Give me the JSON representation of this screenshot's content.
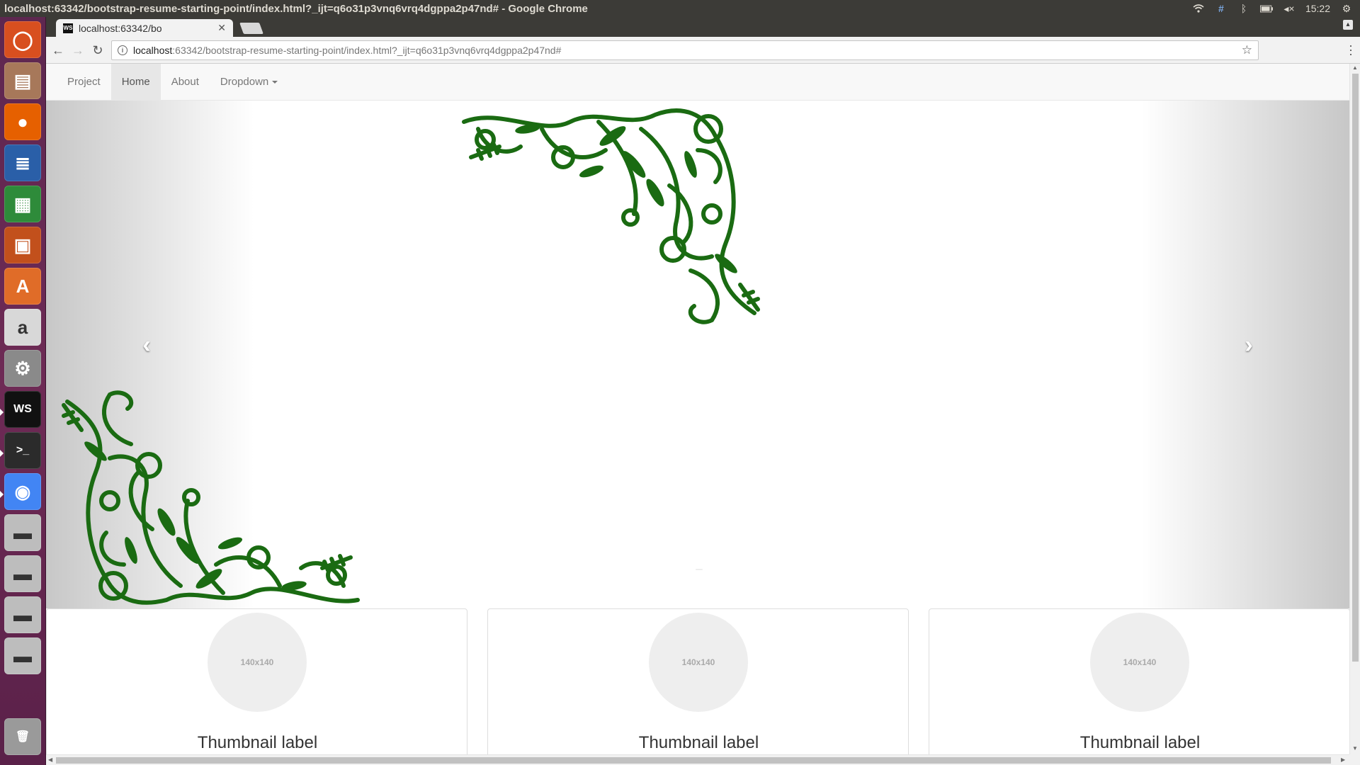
{
  "window": {
    "title": "localhost:63342/bootstrap-resume-starting-point/index.html?_ijt=q6o31p3vnq6vrq4dgppa2p47nd# - Google Chrome",
    "clock": "15:22"
  },
  "tray_icons": [
    "wifi-icon",
    "keyboard-icon",
    "bluetooth-icon",
    "battery-icon",
    "volume-icon",
    "settings-gear-icon"
  ],
  "launcher": {
    "items": [
      {
        "name": "ubuntu-dash-icon",
        "color": "#d84f1f",
        "glyph": "◯"
      },
      {
        "name": "files-icon",
        "color": "#a7785a",
        "glyph": "▤"
      },
      {
        "name": "firefox-icon",
        "color": "#e66000",
        "glyph": "●"
      },
      {
        "name": "writer-icon",
        "color": "#2a5fa8",
        "glyph": "≣"
      },
      {
        "name": "calc-icon",
        "color": "#2e8b3a",
        "glyph": "▦"
      },
      {
        "name": "impress-icon",
        "color": "#c2501c",
        "glyph": "▣"
      },
      {
        "name": "software-center-icon",
        "color": "#e06c28",
        "glyph": "A"
      },
      {
        "name": "amazon-icon",
        "color": "#d8d8d8",
        "glyph": "a"
      },
      {
        "name": "system-settings-icon",
        "color": "#8a8a8a",
        "glyph": "⚙"
      },
      {
        "name": "webstorm-icon",
        "color": "#111111",
        "glyph": "WS"
      },
      {
        "name": "terminal-icon",
        "color": "#2b2b2b",
        "glyph": ">_"
      },
      {
        "name": "chrome-icon",
        "color": "#4285f4",
        "glyph": "◉"
      },
      {
        "name": "drive-icon-1",
        "color": "#bdbdbd",
        "glyph": "▬"
      },
      {
        "name": "drive-icon-2",
        "color": "#bdbdbd",
        "glyph": "▬"
      },
      {
        "name": "drive-icon-3",
        "color": "#bdbdbd",
        "glyph": "▬"
      },
      {
        "name": "drive-icon-4",
        "color": "#bdbdbd",
        "glyph": "▬"
      },
      {
        "name": "trash-icon",
        "color": "#9a9a9a",
        "glyph": "🗑"
      }
    ]
  },
  "browser": {
    "tab_title": "localhost:63342/bo",
    "favicon": "WS",
    "url_host": "localhost",
    "url_rest": ":63342/bootstrap-resume-starting-point/index.html?_ijt=q6o31p3vnq6vrq4dgppa2p47nd#"
  },
  "navbar": {
    "items": [
      {
        "label": "Project",
        "active": false
      },
      {
        "label": "Home",
        "active": true
      },
      {
        "label": "About",
        "active": false
      },
      {
        "label": "Dropdown",
        "active": false
      }
    ]
  },
  "carousel": {
    "prev": "‹",
    "next": "›",
    "ornament_color": "#1a6b12"
  },
  "thumbnails": [
    {
      "image_text": "140x140",
      "label": "Thumbnail label"
    },
    {
      "image_text": "140x140",
      "label": "Thumbnail label"
    },
    {
      "image_text": "140x140",
      "label": "Thumbnail label"
    }
  ]
}
